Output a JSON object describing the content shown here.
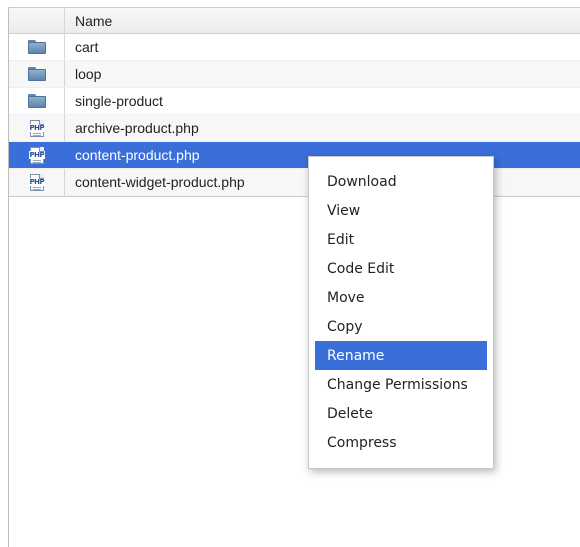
{
  "columns": {
    "name_header": "Name"
  },
  "files": [
    {
      "name": "cart",
      "type": "folder",
      "icon": "folder-icon",
      "selected": false
    },
    {
      "name": "loop",
      "type": "folder",
      "icon": "folder-icon",
      "selected": false
    },
    {
      "name": "single-product",
      "type": "folder",
      "icon": "folder-icon",
      "selected": false
    },
    {
      "name": "archive-product.php",
      "type": "php",
      "icon": "php-file-icon",
      "icon_text": "PHP",
      "selected": false
    },
    {
      "name": "content-product.php",
      "type": "php",
      "icon": "php-file-icon",
      "icon_text": "PHP",
      "selected": true
    },
    {
      "name": "content-widget-product.php",
      "type": "php",
      "icon": "php-file-icon",
      "icon_text": "PHP",
      "selected": false
    }
  ],
  "context_menu": {
    "items": [
      {
        "label": "Download",
        "highlighted": false
      },
      {
        "label": "View",
        "highlighted": false
      },
      {
        "label": "Edit",
        "highlighted": false
      },
      {
        "label": "Code Edit",
        "highlighted": false
      },
      {
        "label": "Move",
        "highlighted": false
      },
      {
        "label": "Copy",
        "highlighted": false
      },
      {
        "label": "Rename",
        "highlighted": true
      },
      {
        "label": "Change Permissions",
        "highlighted": false
      },
      {
        "label": "Delete",
        "highlighted": false
      },
      {
        "label": "Compress",
        "highlighted": false
      }
    ]
  },
  "colors": {
    "selection": "#3a6fd9",
    "header_bg": "#f2f2f2",
    "folder": "#6f94b8",
    "php_icon_text": "#2a4f9a"
  }
}
